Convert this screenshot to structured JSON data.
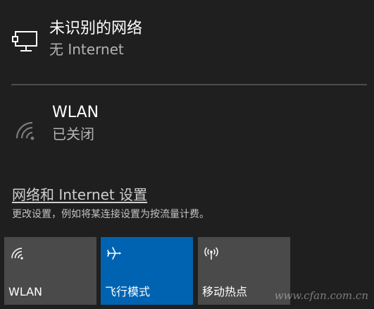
{
  "network": {
    "icon": "ethernet-monitor-icon",
    "title": "未识别的网络",
    "status": "无 Internet"
  },
  "wlan": {
    "icon": "wifi-off-icon",
    "title": "WLAN",
    "status": "已关闭"
  },
  "settings": {
    "link_label": "网络和 Internet 设置",
    "description": "更改设置，例如将某连接设置为按流量计费。"
  },
  "tiles": [
    {
      "id": "wlan",
      "icon": "wifi-icon",
      "label": "WLAN",
      "active": false,
      "color": "#4a4a4a"
    },
    {
      "id": "airplane",
      "icon": "airplane-icon",
      "label": "飞行模式",
      "active": true,
      "color": "#0063b1"
    },
    {
      "id": "hotspot",
      "icon": "mobile-hotspot-icon",
      "label": "移动热点",
      "active": false,
      "color": "#4a4a4a"
    }
  ],
  "watermark": "www.cfan.com.cn",
  "colors": {
    "background": "#1f1f1f",
    "accent": "#0063b1",
    "tile": "#4a4a4a",
    "secondary_text": "#b3b3b3"
  }
}
